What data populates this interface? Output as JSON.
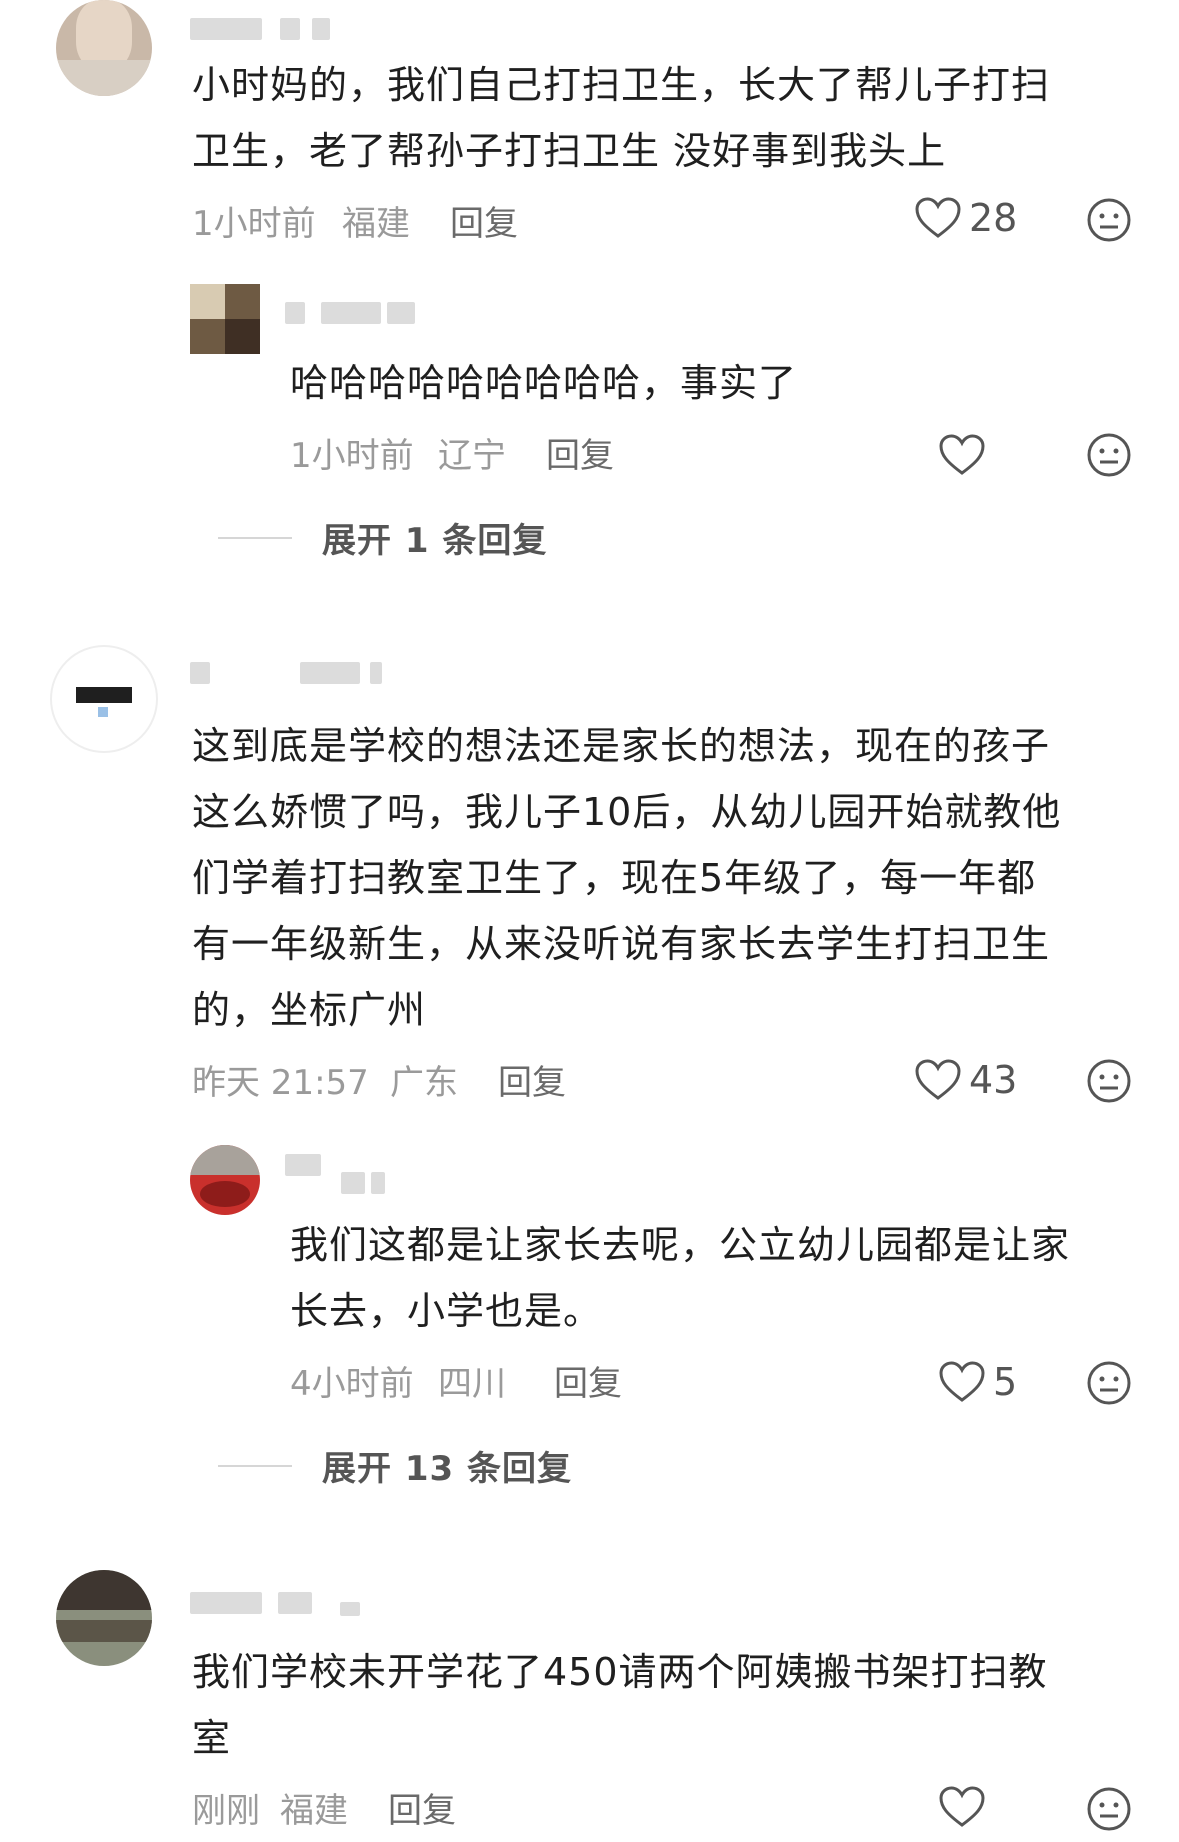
{
  "comments": [
    {
      "text_lines": [
        "小时妈的，我们自己打扫卫生，长大了帮儿子打扫",
        "卫生，老了帮孙子打扫卫生 没好事到我头上"
      ],
      "time": "1小时前",
      "location": "福建",
      "reply_label": "回复",
      "likes": "28",
      "replies": [
        {
          "text_lines": [
            "哈哈哈哈哈哈哈哈哈，事实了"
          ],
          "time": "1小时前",
          "location": "辽宁",
          "reply_label": "回复",
          "likes": ""
        }
      ],
      "expand_label": "展开 1 条回复"
    },
    {
      "text_lines": [
        "这到底是学校的想法还是家长的想法，现在的孩子",
        "这么娇惯了吗，我儿子10后，从幼儿园开始就教他",
        "们学着打扫教室卫生了，现在5年级了，每一年都",
        "有一年级新生，从来没听说有家长去学生打扫卫生",
        "的，坐标广州"
      ],
      "time": "昨天 21:57",
      "location": "广东",
      "reply_label": "回复",
      "likes": "43",
      "replies": [
        {
          "text_lines": [
            "我们这都是让家长去呢，公立幼儿园都是让家",
            "长去，小学也是。"
          ],
          "time": "4小时前",
          "location": "四川",
          "reply_label": "回复",
          "likes": "5"
        }
      ],
      "expand_label": "展开 13 条回复"
    },
    {
      "text_lines": [
        "我们学校未开学花了450请两个阿姨搬书架打扫教",
        "室"
      ],
      "time": "刚刚",
      "location": "福建",
      "reply_label": "回复",
      "likes": ""
    }
  ],
  "colors": {
    "text": "#1f1f1f",
    "meta": "#9a9a9a",
    "icon": "#555555"
  },
  "icons": [
    "heart-icon",
    "neutral-face-icon"
  ]
}
